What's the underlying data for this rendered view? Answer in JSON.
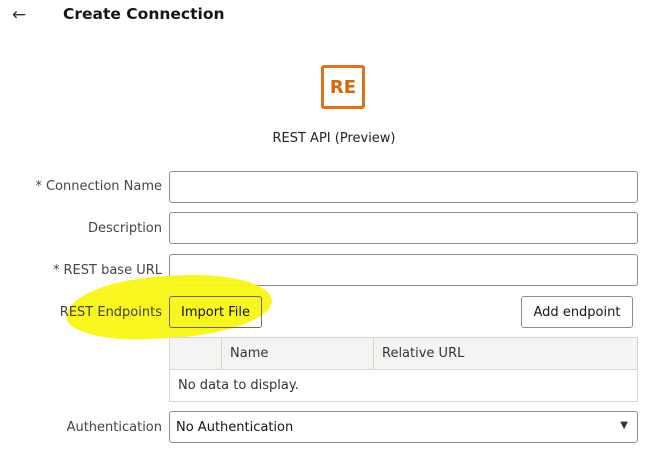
{
  "header": {
    "back_icon": "←",
    "title": "Create Connection"
  },
  "connector": {
    "logo_text": "RE",
    "logo_color": "#e0711c",
    "type_label": "REST API (Preview)"
  },
  "form": {
    "required_marker": "*",
    "connection_name_label": "Connection Name",
    "connection_name_value": "",
    "description_label": "Description",
    "description_value": "",
    "base_url_label": "REST base URL",
    "base_url_value": "",
    "endpoints_label": "REST Endpoints",
    "import_file_label": "Import File",
    "add_endpoint_label": "Add endpoint",
    "endpoints_table": {
      "columns": [
        "",
        "Name",
        "Relative URL"
      ],
      "empty_message": "No data to display."
    },
    "authentication_label": "Authentication",
    "authentication_value": "No Authentication",
    "caret_icon": "▼"
  },
  "annotation": {
    "highlight_color": "#f8f514"
  }
}
